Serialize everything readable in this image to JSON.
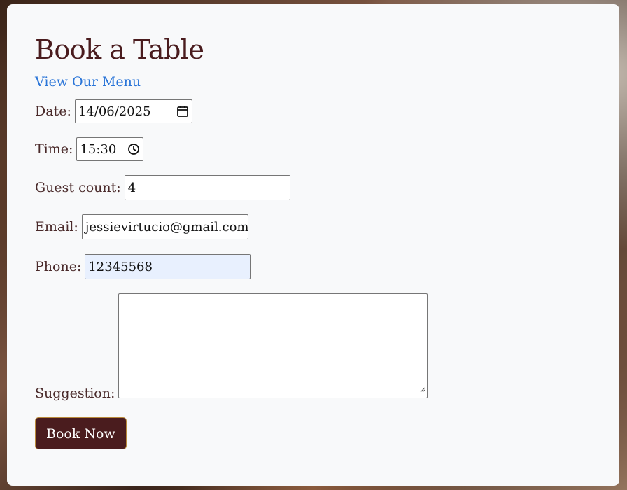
{
  "form": {
    "title": "Book a Table",
    "menu_link": "View Our Menu",
    "date": {
      "label": "Date:",
      "value": "14/06/2025"
    },
    "time": {
      "label": "Time:",
      "value": "15:30"
    },
    "guests": {
      "label": "Guest count:",
      "value": "4"
    },
    "email": {
      "label": "Email:",
      "value": "jessievirtucio@gmail.com"
    },
    "phone": {
      "label": "Phone:",
      "value": "12345568"
    },
    "suggestion": {
      "label": "Suggestion:",
      "value": ""
    },
    "submit_label": "Book Now"
  },
  "icons": {
    "date": "calendar-icon",
    "time": "clock-icon",
    "textarea": "resize-grip-icon"
  },
  "colors": {
    "title": "#4a1c1e",
    "link": "#2a75d8",
    "button": "#4a1c1e",
    "button_border": "#b98a3a",
    "card": "#f8f9fa",
    "autofill": "#e8f0fe"
  }
}
